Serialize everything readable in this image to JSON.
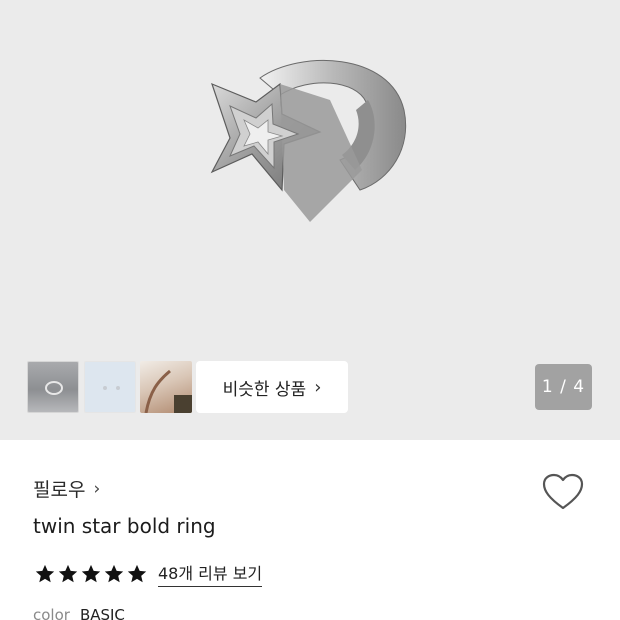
{
  "gallery": {
    "page_counter": "1 / 4",
    "similar_button_label": "비슷한 상품",
    "thumbnails": [
      "ring-thumbnail",
      "earring-thumbnail",
      "model-thumbnail"
    ]
  },
  "product": {
    "brand": "필로우",
    "name": "twin star bold ring",
    "rating_stars": 5,
    "review_link": "48개 리뷰 보기",
    "option_label": "color",
    "option_value": "BASIC"
  },
  "icons": {
    "star": "star-icon",
    "heart": "heart-outline-icon",
    "chevron": "chevron-right-icon"
  },
  "colors": {
    "hero_background": "#ebebeb",
    "counter_badge": "#a2a2a2",
    "star_fill": "#111111"
  }
}
